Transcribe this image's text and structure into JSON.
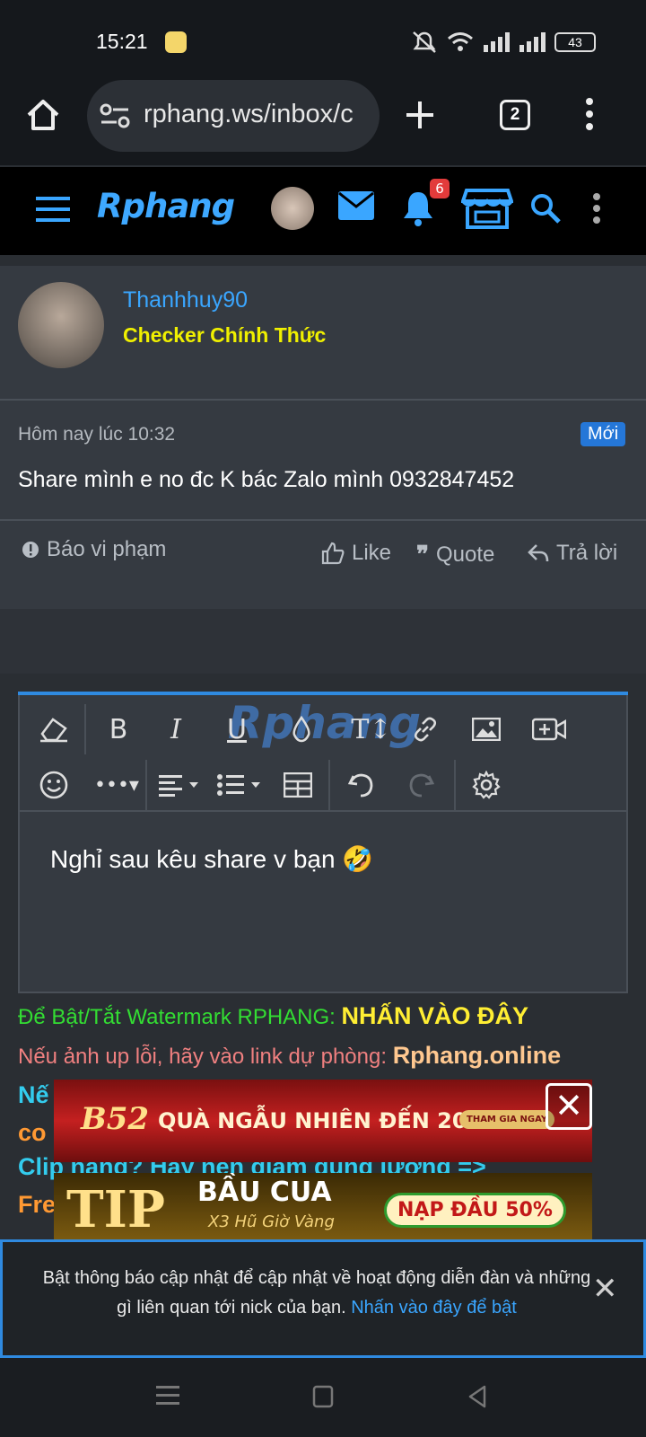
{
  "status_bar": {
    "time": "15:21",
    "battery": "43"
  },
  "browser": {
    "url": "rphang.ws/inbox/c",
    "tab_count": "2"
  },
  "site_header": {
    "logo": "Rphang",
    "notification_count": "6"
  },
  "post": {
    "username": "Thanhhuy90",
    "user_title": "Checker Chính Thức",
    "date": "Hôm nay lúc 10:32",
    "new_badge": "Mới",
    "body": "Share mình e no đc K bác Zalo mình 0932847452",
    "actions": {
      "report": "Báo vi phạm",
      "like": "Like",
      "quote": "Quote",
      "reply": "Trả lời"
    }
  },
  "editor": {
    "watermark": "Rphang",
    "content": "Nghỉ sau kêu share v bạn 🤣"
  },
  "info_lines": {
    "line1_label": "Để Bật/Tắt Watermark RPHANG: ",
    "line1_link": "NHẤN VÀO ĐÂY",
    "line2_label": "Nếu ảnh up lỗi, hãy vào link dự phòng: ",
    "line2_link": "Rphang.online",
    "line3_partial": "Nế",
    "line4_partial": "co",
    "line5_partial": "Clip nặng? Hãy nén giảm dung lượng =>",
    "line6_partial": "Fre"
  },
  "ads": {
    "ad1_brand": "B52",
    "ad1_text": "QUÀ NGẪU NHIÊN ĐẾN 200K",
    "ad1_cta": "THAM GIA NGAY",
    "ad2_brand": "TIP",
    "ad2_title": "BẦU CUA",
    "ad2_sub": "X3 Hũ Giờ Vàng",
    "ad2_cta": "NẠP ĐẦU 50%"
  },
  "notice": {
    "text": "Bật thông báo cập nhật để cập nhật về hoạt động diễn đàn và những gì liên quan tới nick của bạn. ",
    "link": "Nhấn vào đây để bật"
  },
  "colors": {
    "accent_blue": "#3aa6ff",
    "user_title_yellow": "#f0f000",
    "line1_green": "#33dd33",
    "line1_link_yellow": "#ffee33",
    "line2_pink": "#f08080",
    "line2_link_peach": "#ffc890",
    "cyan": "#33ccee",
    "orange": "#ff9933"
  }
}
